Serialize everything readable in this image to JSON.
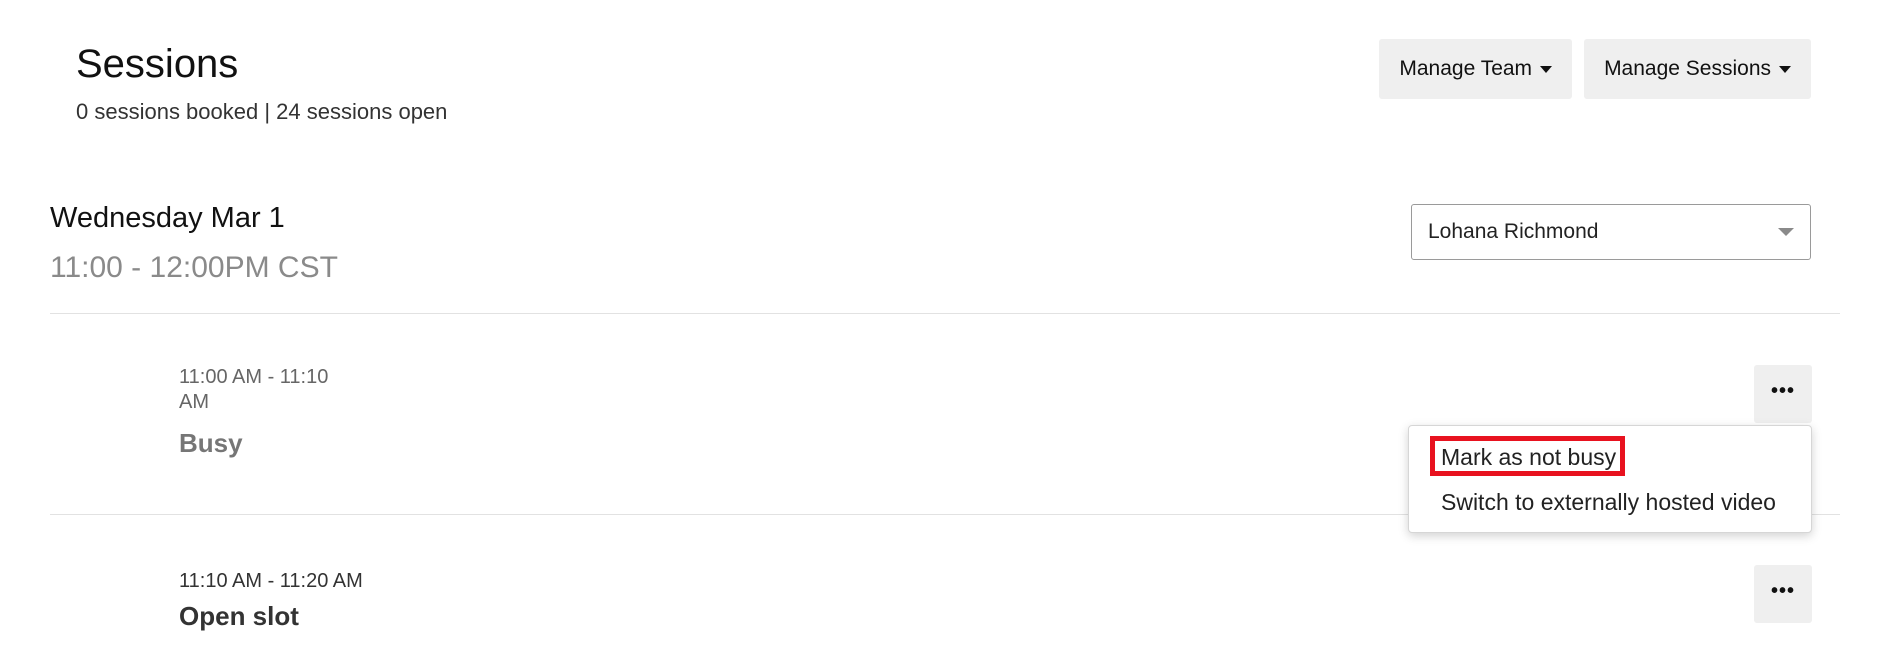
{
  "header": {
    "title": "Sessions",
    "summary": "0 sessions booked | 24 sessions open"
  },
  "actions": {
    "manage_team": "Manage Team",
    "manage_sessions": "Manage Sessions"
  },
  "day": {
    "title": "Wednesday Mar 1",
    "time_range": "11:00 - 12:00PM CST"
  },
  "host_select": {
    "selected": "Lohana Richmond"
  },
  "slots": [
    {
      "time": "11:00 AM - 11:10 AM",
      "status": "Busy"
    },
    {
      "time": "11:10 AM - 11:20 AM",
      "status": "Open slot"
    }
  ],
  "slot_menu": {
    "items": [
      "Mark as not busy",
      "Switch to externally hosted video"
    ]
  },
  "more_icon_glyph": "•••",
  "colors": {
    "highlight": "#e8121f",
    "button_bg": "#efefef"
  },
  "icons": {
    "caret": "caret-down-icon",
    "more": "more-horizontal-icon"
  }
}
